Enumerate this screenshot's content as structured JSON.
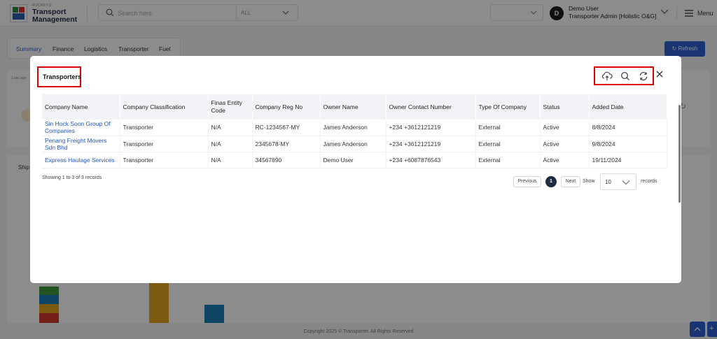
{
  "app": {
    "brand_small": "ROCKEYS",
    "title_line1": "Transport",
    "title_line2": "Management"
  },
  "search": {
    "placeholder": "Search here",
    "scope": "ALL"
  },
  "user": {
    "initial": "D",
    "name": "Demo User",
    "role": "Transporter Admin [Holistic O&G]"
  },
  "menu_label": "Menu",
  "subnav": {
    "tabs": [
      "Summary",
      "Finance",
      "Logistics",
      "Transporter",
      "Fuel"
    ],
    "active": "Summary"
  },
  "refresh_label": "Refresh",
  "bg_labels": {
    "ship": "Ship",
    "time": "1 sec ago"
  },
  "footer": "Copyright 2025 © Transporter. All Rights Reserved",
  "colors": {
    "accent": "#2d5fd0",
    "link": "#2356c5",
    "highlight_border": "#dd0000"
  },
  "modal": {
    "title": "Transporters",
    "tools": [
      "cloud-upload-icon",
      "search-icon",
      "refresh-icon"
    ],
    "columns": [
      "Company Name",
      "Company Classification",
      "Finas Entity Code",
      "Company Reg No",
      "Owner Name",
      "Owner Contact Number",
      "Type Of Company",
      "Status",
      "Added Date"
    ],
    "rows": [
      [
        "Sin Hock Soon Group Of Companies",
        "Transporter",
        "N/A",
        "RC-1234567-MY",
        "James Anderson",
        "+234 +3612121219",
        "External",
        "Active",
        "8/8/2024"
      ],
      [
        "Penang Freight Movers Sdn Bhd",
        "Transporter",
        "N/A",
        "2345678-MY",
        "James Anderson",
        "+234 +3612121219",
        "External",
        "Active",
        "9/8/2024"
      ],
      [
        "Express Haulage Services",
        "Transporter",
        "N/A",
        "34567890",
        "Demo User",
        "+234 +6087876543",
        "External",
        "Active",
        "19/11/2024"
      ]
    ],
    "showing": "Showing 1 to 3 of 3 records",
    "pagination": {
      "previous": "Previous",
      "current_page": "1",
      "next": "Next",
      "show_label": "Show",
      "page_size": "10",
      "records_label": "records"
    }
  }
}
